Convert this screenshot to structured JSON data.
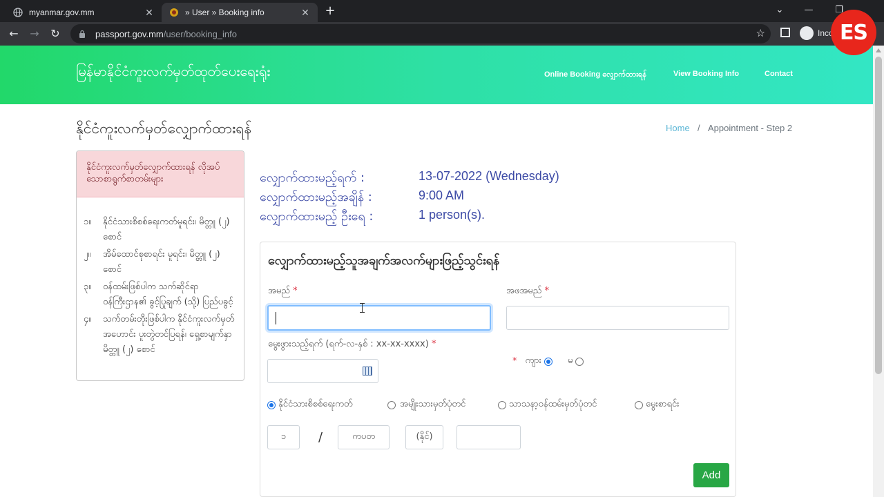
{
  "browser": {
    "tabs": [
      {
        "title": "myanmar.gov.mm",
        "active": false
      },
      {
        "title": "» User » Booking info",
        "active": true
      }
    ],
    "url_host": "passport.gov.mm",
    "url_path": "/user/booking_info",
    "incognito_label": "Inco"
  },
  "overlay": {
    "logo_text": "ES"
  },
  "site": {
    "brand": "မြန်မာနိုင်ငံကူးလက်မှတ်ထုတ်ပေးရေးရုံး",
    "nav": [
      "Online Booking လျှောက်ထားရန်",
      "View Booking Info",
      "Contact"
    ]
  },
  "page": {
    "title": "နိုင်ငံကူးလက်မှတ်လျှောက်ထားရန်",
    "breadcrumb": {
      "home": "Home",
      "separator": "/",
      "current": "Appointment - Step 2"
    }
  },
  "requirements": {
    "header": "နိုင်ငံကူးလက်မှတ်လျှောက်ထားရန် လိုအပ်သောစာရွက်စာတမ်းများ",
    "items": [
      {
        "num": "၁။",
        "text": "နိုင်ငံသားစိစစ်ရေးကတ်မူရင်း၊ မိတ္တူ (၂) စောင်"
      },
      {
        "num": "၂။",
        "text": "အိမ်ထောင်စုစာရင်း မူရင်း၊ မိတ္တူ (၂) စောင်"
      },
      {
        "num": "၃။",
        "text": "ဝန်ထမ်းဖြစ်ပါက သက်ဆိုင်ရာ ဝန်ကြီးဌာန၏ ခွင့်ပြုချက် (သို့) ပြည်ပခွင့်"
      },
      {
        "num": "၄။",
        "text": "သက်တမ်းတိုးဖြစ်ပါက နိုင်ငံကူးလက်မှတ်အဟောင်း ပူးတွဲတင်ပြရန်၊ ရှေ့စာမျက်နှာမိတ္တူ (၂) စောင်"
      }
    ]
  },
  "booking": {
    "rows": [
      {
        "label": "လျှောက်ထားမည့်ရက် :",
        "value": "13-07-2022 (Wednesday)"
      },
      {
        "label": "လျှောက်ထားမည့်အချိန် :",
        "value": "9:00 AM"
      },
      {
        "label": "လျှောက်ထားမည့် ဦးရေ :",
        "value": "1 person(s)."
      }
    ]
  },
  "form": {
    "title": "လျှောက်ထားမည့်သူအချက်အလက်များဖြည့်သွင်းရန်",
    "name_label": "အမည်",
    "father_label": "အဖအမည်",
    "dob_label": "မွေးဖွားသည့်ရက် (ရက်-လ-နှစ် : xx-xx-xxxx)",
    "required_mark": "*",
    "name_value": "",
    "father_value": "",
    "dob_value": "",
    "gender": {
      "male": "ကျား",
      "female": "မ",
      "selected": "male"
    },
    "id_types": [
      {
        "label": "နိုင်ငံသားစိစစ်ရေးကတ်",
        "selected": true
      },
      {
        "label": "အမျိုးသားမှတ်ပုံတင်",
        "selected": false
      },
      {
        "label": "သာသနာ့ဝန်ထမ်းမှတ်ပုံတင်",
        "selected": false
      },
      {
        "label": "မွေးစာရင်း",
        "selected": false
      }
    ],
    "nrc": {
      "state": "၁",
      "slash": "/",
      "township": "ကပတ",
      "type": "(နိုင်)",
      "number": ""
    },
    "add_button": "Add"
  }
}
